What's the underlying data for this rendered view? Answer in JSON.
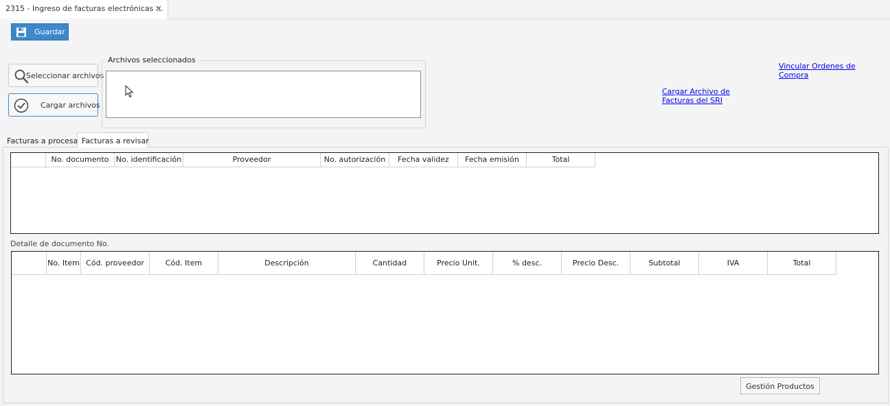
{
  "document_tab": {
    "title": "2315 - Ingreso de facturas electrónicas ::.",
    "close_icon": "close-icon",
    "close_glyph": "×"
  },
  "toolbar": {
    "save_label": "Guardar",
    "save_icon": "floppy-disk-icon"
  },
  "file_actions": {
    "select_label": "Seleccionar archivos",
    "select_icon": "magnifier-icon",
    "upload_label": "Cargar archivos",
    "upload_icon": "check-circle-icon"
  },
  "selected_files": {
    "title": "Archivos seleccionados",
    "items": []
  },
  "links": {
    "vincular": "Vincular Ordenes de Compra",
    "cargar_sri": "Cargar Archivo de Facturas del SRI"
  },
  "tabs": [
    {
      "label": "Facturas a procesar",
      "active": false
    },
    {
      "label": "Facturas a revisar",
      "active": true
    }
  ],
  "invoice_grid": {
    "columns": [
      "",
      "No. documento",
      "No. identificación",
      "Proveedor",
      "No. autorización",
      "Fecha validez",
      "Fecha emisión",
      "Total"
    ],
    "rows": []
  },
  "detail": {
    "label": "Detalle de documento No.",
    "columns": [
      "",
      "No. Item",
      "Cód. proveedor",
      "Cód. Item",
      "Descripción",
      "Cantidad",
      "Precio Unit.",
      "% desc.",
      "Precio Desc.",
      "Subtotal",
      "IVA",
      "Total"
    ],
    "rows": []
  },
  "footer": {
    "products_label": "Gestión Productos"
  },
  "colors": {
    "accent": "#3e87cc",
    "link": "#0000ee",
    "grid_border": "#1e1e1e"
  }
}
